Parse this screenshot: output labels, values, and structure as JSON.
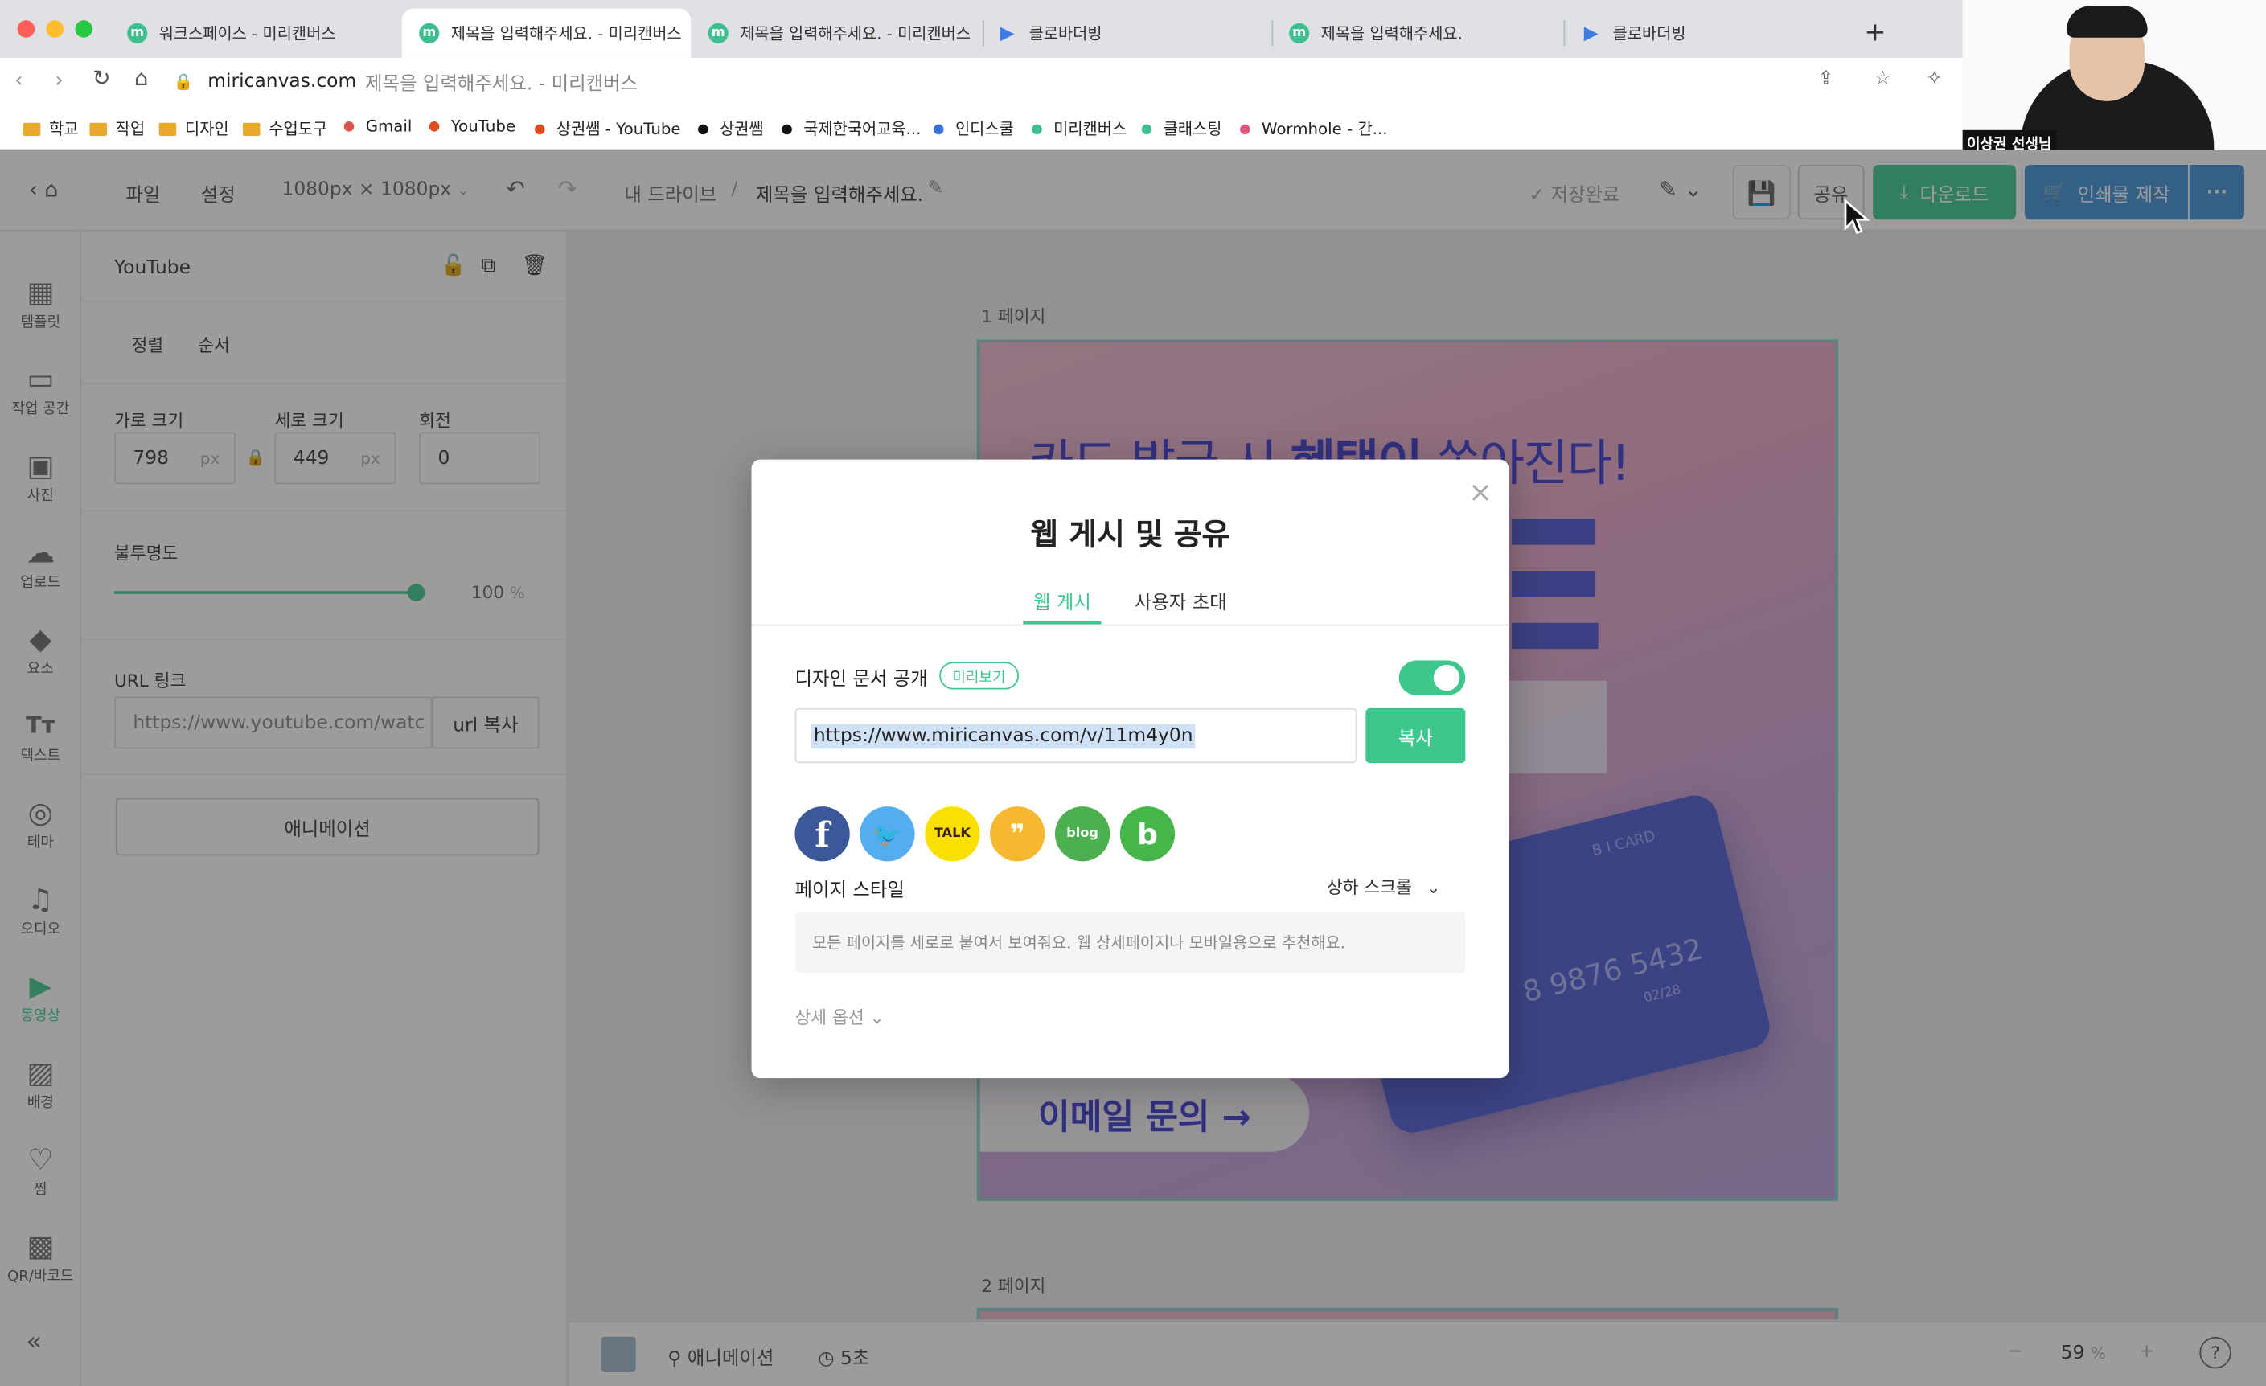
{
  "browser": {
    "tabs": [
      {
        "title": "워크스페이스 - 미리캔버스",
        "fav": "m"
      },
      {
        "title": "제목을 입력해주세요. - 미리캔버스",
        "fav": "m"
      },
      {
        "title": "제목을 입력해주세요. - 미리캔버스",
        "fav": "m"
      },
      {
        "title": "클로바더빙",
        "fav": "▶"
      },
      {
        "title": "제목을 입력해주세요.",
        "fav": "m"
      },
      {
        "title": "클로바더빙",
        "fav": "▶"
      }
    ],
    "new_tab": "+",
    "url_domain": "miricanvas.com",
    "url_title": "제목을 입력해주세요. - 미리캔버스",
    "bookmarks": [
      {
        "label": "학교",
        "kind": "folder"
      },
      {
        "label": "작업",
        "kind": "folder"
      },
      {
        "label": "디자인",
        "kind": "folder"
      },
      {
        "label": "수업도구",
        "kind": "folder"
      },
      {
        "label": "Gmail",
        "kind": "dot",
        "color": "#d9534f"
      },
      {
        "label": "YouTube",
        "kind": "dot",
        "color": "#e0491b"
      },
      {
        "label": "상권쌤 - YouTube",
        "kind": "dot",
        "color": "#e0491b"
      },
      {
        "label": "상권쌤",
        "kind": "dot",
        "color": "#111111"
      },
      {
        "label": "국제한국어교육...",
        "kind": "dot",
        "color": "#111111"
      },
      {
        "label": "인디스쿨",
        "kind": "dot",
        "color": "#3b6fd8"
      },
      {
        "label": "미리캔버스",
        "kind": "dot",
        "color": "#3fbf8f"
      },
      {
        "label": "클래스팅",
        "kind": "dot",
        "color": "#3fbf8f"
      },
      {
        "label": "Wormhole - 간...",
        "kind": "dot",
        "color": "#e05a7a"
      }
    ]
  },
  "webcam": {
    "name": "이상권 선생님"
  },
  "toolbar": {
    "file": "파일",
    "settings": "설정",
    "size": "1080px × 1080px",
    "breadcrumb_root": "내 드라이브",
    "breadcrumb_sep": "/",
    "doc_title": "제목을 입력해주세요.",
    "save_status": "저장완료",
    "share": "공유",
    "download": "다운로드",
    "print": "인쇄물 제작",
    "more": "···"
  },
  "rail": [
    {
      "icon": "▦",
      "label": "템플릿"
    },
    {
      "icon": "▭",
      "label": "작업 공간"
    },
    {
      "icon": "▣",
      "label": "사진"
    },
    {
      "icon": "☁",
      "label": "업로드"
    },
    {
      "icon": "◆",
      "label": "요소"
    },
    {
      "icon": "Tт",
      "label": "텍스트"
    },
    {
      "icon": "◎",
      "label": "테마"
    },
    {
      "icon": "♫",
      "label": "오디오"
    },
    {
      "icon": "▶",
      "label": "동영상"
    },
    {
      "icon": "▨",
      "label": "배경"
    },
    {
      "icon": "♡",
      "label": "찜"
    },
    {
      "icon": "▩",
      "label": "QR/바코드"
    }
  ],
  "rail_collapse": "«",
  "panel": {
    "title": "YouTube",
    "tab_align": "정렬",
    "tab_order": "순서",
    "width_label": "가로 크기",
    "height_label": "세로 크기",
    "rotate_label": "회전",
    "width": "798",
    "height": "449",
    "rotate": "0",
    "unit": "px",
    "opacity_label": "불투명도",
    "opacity": 100,
    "opacity_unit": "%",
    "url_label": "URL 링크",
    "url_value": "https://www.youtube.com/watc",
    "url_copy": "url 복사",
    "animation": "애니메이션"
  },
  "canvas": {
    "page1": "1 페이지",
    "page2": "2 페이지",
    "headline_a": "카드 발급 시 ",
    "headline_b": "혜택이",
    "headline_c": " 쏟아진다!",
    "card_label": "B I CARD",
    "card_number": "8 9876 5432",
    "card_valid": "02/28",
    "email_btn": "이메일 문의 →"
  },
  "bottom": {
    "animation": "애니메이션",
    "duration": "5초",
    "zoom": "59",
    "zoom_unit": "%"
  },
  "modal": {
    "title": "웹 게시 및 공유",
    "tab_publish": "웹 게시",
    "tab_invite": "사용자 초대",
    "public_label": "디자인 문서 공개",
    "preview_badge": "미리보기",
    "toggle_on": true,
    "link": "https://www.miricanvas.com/v/11m4y0n",
    "copy": "복사",
    "socials": [
      {
        "icon": "facebook-icon",
        "glyph": "f",
        "color": "#3b5998"
      },
      {
        "icon": "twitter-icon",
        "glyph": "🐦",
        "color": "#55acee"
      },
      {
        "icon": "kakaotalk-icon",
        "glyph": "TALK",
        "color": "#f9e000"
      },
      {
        "icon": "kakaostory-icon",
        "glyph": "❞",
        "color": "#f5b82e"
      },
      {
        "icon": "naver-blog-icon",
        "glyph": "blog",
        "color": "#4caf50"
      },
      {
        "icon": "band-icon",
        "glyph": "b",
        "color": "#45b649"
      }
    ],
    "page_style_label": "페이지 스타일",
    "page_style_value": "상하 스크롤",
    "page_style_desc": "모든 페이지를 세로로 붙여서 보여줘요. 웹 상세페이지나 모바일용으로 추천해요.",
    "advanced": "상세 옵션",
    "close": "×"
  }
}
